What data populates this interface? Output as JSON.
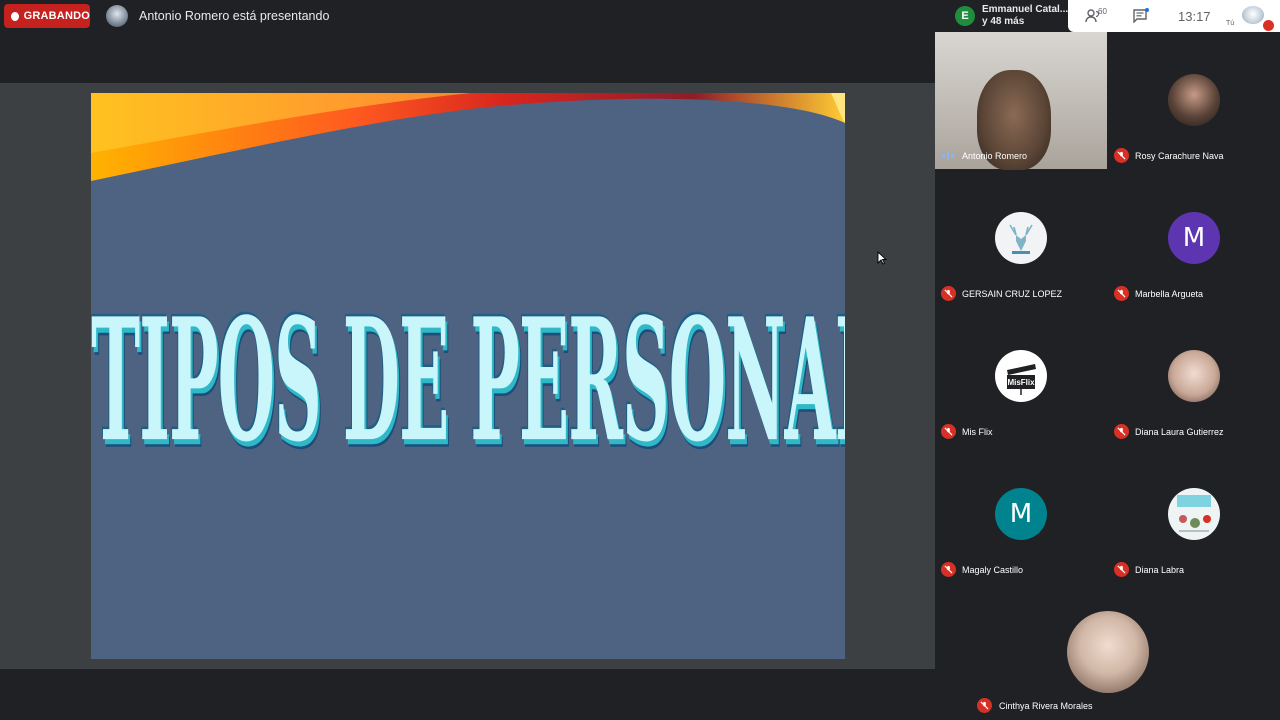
{
  "topbar": {
    "recording_label": "GRABANDO",
    "presenting_text": "Antonio Romero está presentando",
    "speaker_initial": "E",
    "speaker_name": "Emmanuel Catal...",
    "speaker_more": "y 48 más",
    "participant_count": "60",
    "clock": "13:17",
    "self_label": "Tú"
  },
  "slide": {
    "title": "TIPOS DE PERSONALIDADES"
  },
  "participants": [
    {
      "name": "Antonio Romero",
      "initial": "",
      "color": "#000000",
      "muted": false,
      "video": true
    },
    {
      "name": "Rosy Carachure Nava",
      "initial": "",
      "color": "#6b5a4f",
      "muted": true
    },
    {
      "name": "GERSAIN CRUZ LOPEZ",
      "initial": "",
      "color": "#f1f3f4",
      "muted": true
    },
    {
      "name": "Marbella Argueta",
      "initial": "M",
      "color": "#5e35b1",
      "muted": true
    },
    {
      "name": "Mis Flix",
      "initial": "MisFlix",
      "color": "#ffffff",
      "muted": true
    },
    {
      "name": "Diana Laura Gutierrez",
      "initial": "",
      "color": "#d8c8bf",
      "muted": true
    },
    {
      "name": "Magaly Castillo",
      "initial": "M",
      "color": "#00838f",
      "muted": true
    },
    {
      "name": "Diana Labra",
      "initial": "",
      "color": "#eef3f4",
      "muted": true
    },
    {
      "name": "Cinthya Rivera Morales",
      "initial": "",
      "color": "#d2c4bb",
      "muted": true
    }
  ],
  "colors": {
    "recording": "#c5221f",
    "muted": "#d93025",
    "slide_background": "#4e6282",
    "title_text": "#c9f6fb"
  }
}
